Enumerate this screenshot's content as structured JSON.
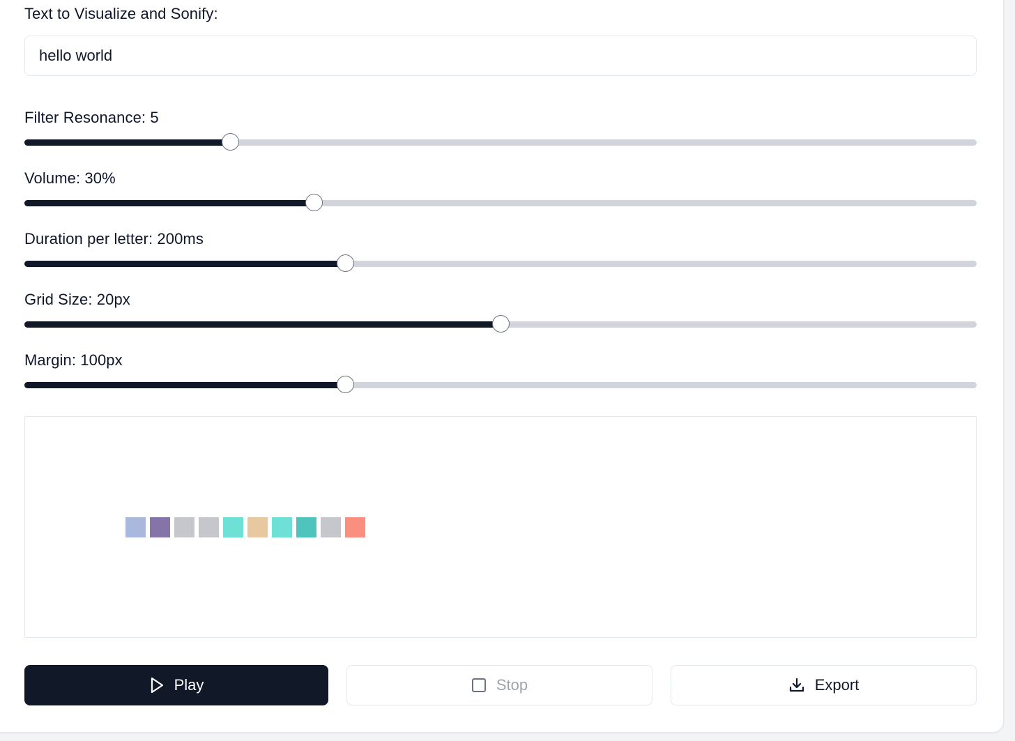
{
  "text_section": {
    "label": "Text to Visualize and Sonify:",
    "value": "hello world"
  },
  "sliders": [
    {
      "label": "Filter Resonance: 5",
      "fraction": 0.216
    },
    {
      "label": "Volume: 30%",
      "fraction": 0.304
    },
    {
      "label": "Duration per letter: 200ms",
      "fraction": 0.337
    },
    {
      "label": "Grid Size: 20px",
      "fraction": 0.5
    },
    {
      "label": "Margin: 100px",
      "fraction": 0.337
    }
  ],
  "visualization": {
    "cells": [
      "#a9b8dc",
      "#8574a8",
      "#c6c7cc",
      "#c6c7cc",
      "#6ee0d6",
      "#e7c8a0",
      "#6ee0d6",
      "#4fc4bc",
      "#c6c7cc",
      "#fb8f7f"
    ]
  },
  "buttons": {
    "play_label": "Play",
    "play_icon": "play-icon",
    "stop_label": "Stop",
    "stop_icon": "square-icon",
    "export_label": "Export",
    "export_icon": "download-icon"
  },
  "colors": {
    "primary": "#111827",
    "track": "#d1d5db",
    "disabled_text": "#9ca3af"
  }
}
